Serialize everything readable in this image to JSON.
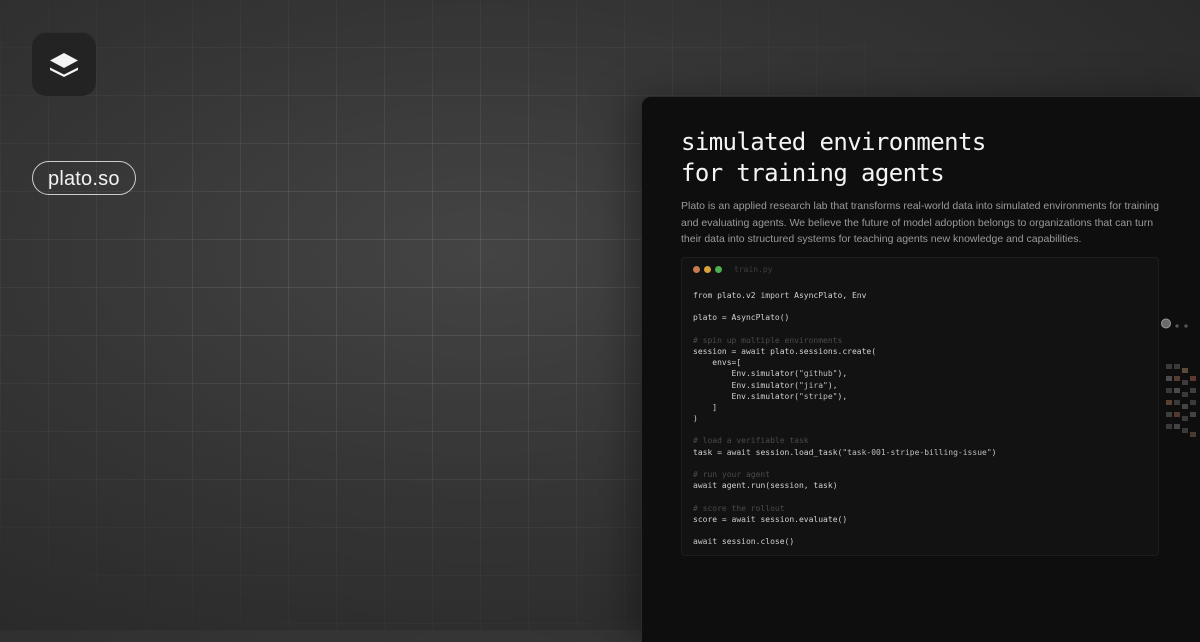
{
  "brand": {
    "logo_icon": "layers-icon",
    "domain": "plato.so"
  },
  "hero": {
    "headline_line1": "simulated environments",
    "headline_line2": "for training agents",
    "description": "Plato is an applied research lab that transforms real-world data into simulated environments for training and evaluating agents. We believe the future of model adoption belongs to organizations that can turn their data into structured systems for teaching agents new knowledge and capabilities."
  },
  "code_window": {
    "filename": "train.py",
    "dot_colors": [
      "#c87a4e",
      "#d9a13a",
      "#4caf50"
    ],
    "lines": [
      [
        {
          "t": "kw",
          "v": "from"
        },
        {
          "t": "tx",
          "v": " plato.v2 "
        },
        {
          "t": "kw",
          "v": "import"
        },
        {
          "t": "tx",
          "v": " AsyncPlato, Env"
        }
      ],
      [],
      [
        {
          "t": "tx",
          "v": "plato = AsyncPlato()"
        }
      ],
      [],
      [
        {
          "t": "cm",
          "v": "# spin up multiple environments"
        }
      ],
      [
        {
          "t": "tx",
          "v": "session = "
        },
        {
          "t": "kw",
          "v": "await"
        },
        {
          "t": "tx",
          "v": " plato.sessions.create("
        }
      ],
      [
        {
          "t": "tx",
          "v": "    envs=["
        }
      ],
      [
        {
          "t": "tx",
          "v": "        Env.simulator("
        },
        {
          "t": "str",
          "v": "\"github\""
        },
        {
          "t": "tx",
          "v": "),"
        }
      ],
      [
        {
          "t": "tx",
          "v": "        Env.simulator("
        },
        {
          "t": "str",
          "v": "\"jira\""
        },
        {
          "t": "tx",
          "v": "),"
        }
      ],
      [
        {
          "t": "tx",
          "v": "        Env.simulator("
        },
        {
          "t": "str",
          "v": "\"stripe\""
        },
        {
          "t": "tx",
          "v": "),"
        }
      ],
      [
        {
          "t": "tx",
          "v": "    ]"
        }
      ],
      [
        {
          "t": "tx",
          "v": ")"
        }
      ],
      [],
      [
        {
          "t": "cm",
          "v": "# load a verifiable task"
        }
      ],
      [
        {
          "t": "tx",
          "v": "task = "
        },
        {
          "t": "kw",
          "v": "await"
        },
        {
          "t": "tx",
          "v": " session.load_task("
        },
        {
          "t": "str",
          "v": "\"task-001-stripe-billing-issue\""
        },
        {
          "t": "tx",
          "v": ")"
        }
      ],
      [],
      [
        {
          "t": "cm",
          "v": "# run your agent"
        }
      ],
      [
        {
          "t": "kw",
          "v": "await"
        },
        {
          "t": "tx",
          "v": " agent.run(session, task)"
        }
      ],
      [],
      [
        {
          "t": "cm",
          "v": "# score the rollout"
        }
      ],
      [
        {
          "t": "tx",
          "v": "score = "
        },
        {
          "t": "kw",
          "v": "await"
        },
        {
          "t": "tx",
          "v": " session.evaluate()"
        }
      ],
      [],
      [
        {
          "t": "kw",
          "v": "await"
        },
        {
          "t": "tx",
          "v": " session.close()"
        }
      ]
    ]
  },
  "colors": {
    "background": "#353535",
    "panel": "#0e0e0e",
    "code_bg": "#121212",
    "headline": "#f4f4f4",
    "body_text": "#9a9a9a"
  }
}
